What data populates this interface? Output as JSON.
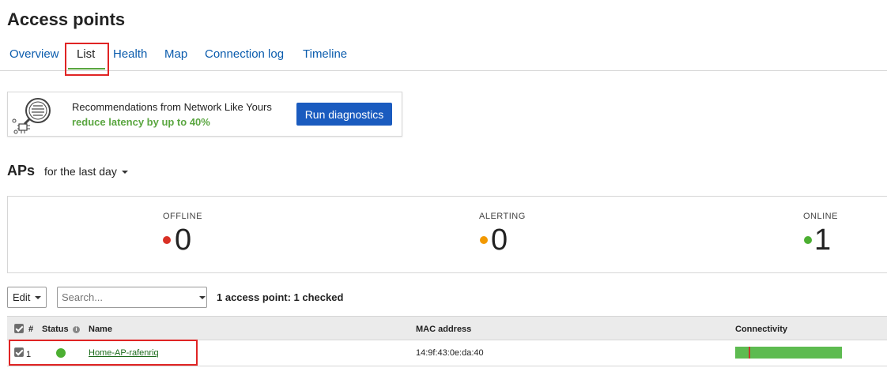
{
  "page": {
    "title": "Access points"
  },
  "tabs": [
    {
      "label": "Overview",
      "active": false
    },
    {
      "label": "List",
      "active": true
    },
    {
      "label": "Health",
      "active": false
    },
    {
      "label": "Map",
      "active": false
    },
    {
      "label": "Connection log",
      "active": false
    },
    {
      "label": "Timeline",
      "active": false
    }
  ],
  "recommendation": {
    "line1": "Recommendations from Network Like Yours",
    "line2": "reduce latency by up to 40%",
    "button": "Run diagnostics"
  },
  "aps": {
    "title": "APs",
    "period": "for the last day"
  },
  "summary": {
    "offline": {
      "label": "OFFLINE",
      "count": "0",
      "color": "#d93025"
    },
    "alerting": {
      "label": "ALERTING",
      "count": "0",
      "color": "#f29900"
    },
    "online": {
      "label": "ONLINE",
      "count": "1",
      "color": "#4caf32"
    }
  },
  "toolbar": {
    "edit_label": "Edit",
    "search_placeholder": "Search...",
    "count_text": "1 access point: 1 checked"
  },
  "table": {
    "headers": {
      "number": "#",
      "status": "Status",
      "name": "Name",
      "mac": "MAC address",
      "connectivity": "Connectivity"
    },
    "rows": [
      {
        "checked": true,
        "number": "1",
        "status": "online",
        "name": "Home-AP-rafenriq",
        "mac": "14:9f:43:0e:da:40"
      }
    ]
  },
  "icons": {
    "reco": "magnifier-circuit-icon",
    "info": "info-icon",
    "status": "status-dot-icon",
    "caret": "caret-down-icon"
  }
}
